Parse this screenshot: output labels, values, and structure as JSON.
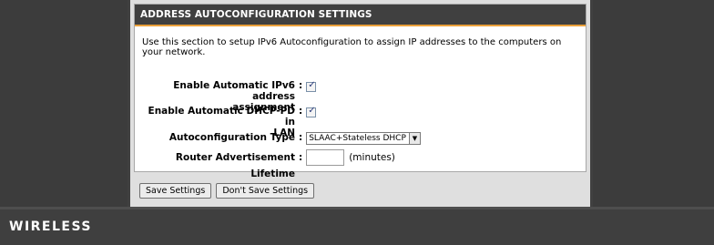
{
  "section": {
    "title": "ADDRESS AUTOCONFIGURATION SETTINGS",
    "description": "Use this section to setup IPv6 Autoconfiguration to assign IP addresses to the computers on your network."
  },
  "fields": {
    "auto_ipv6": {
      "label_line1": "Enable Automatic IPv6 address",
      "label_line2": "assignment",
      "colon": ":",
      "checked": true,
      "check_glyph": "✓"
    },
    "dhcp_pd": {
      "label_line1": "Enable Automatic DHCP-PD in",
      "label_line2": "LAN",
      "colon": ":",
      "checked": true,
      "check_glyph": "✓"
    },
    "autoconfig_type": {
      "label": "Autoconfiguration Type",
      "colon": ":",
      "selected": "SLAAC+Stateless DHCP",
      "arrow_glyph": "▼"
    },
    "ra_lifetime": {
      "label": "Router Advertisement Lifetime",
      "colon": ":",
      "value": "",
      "unit": "(minutes)"
    }
  },
  "buttons": {
    "save": "Save Settings",
    "dont_save": "Don't Save Settings"
  },
  "footer": {
    "brand": "WIRELESS"
  },
  "colors": {
    "header_accent": "#eba03a",
    "header_bg": "#404040",
    "page_bg": "#404040",
    "content_bg": "#dfdfdf"
  }
}
